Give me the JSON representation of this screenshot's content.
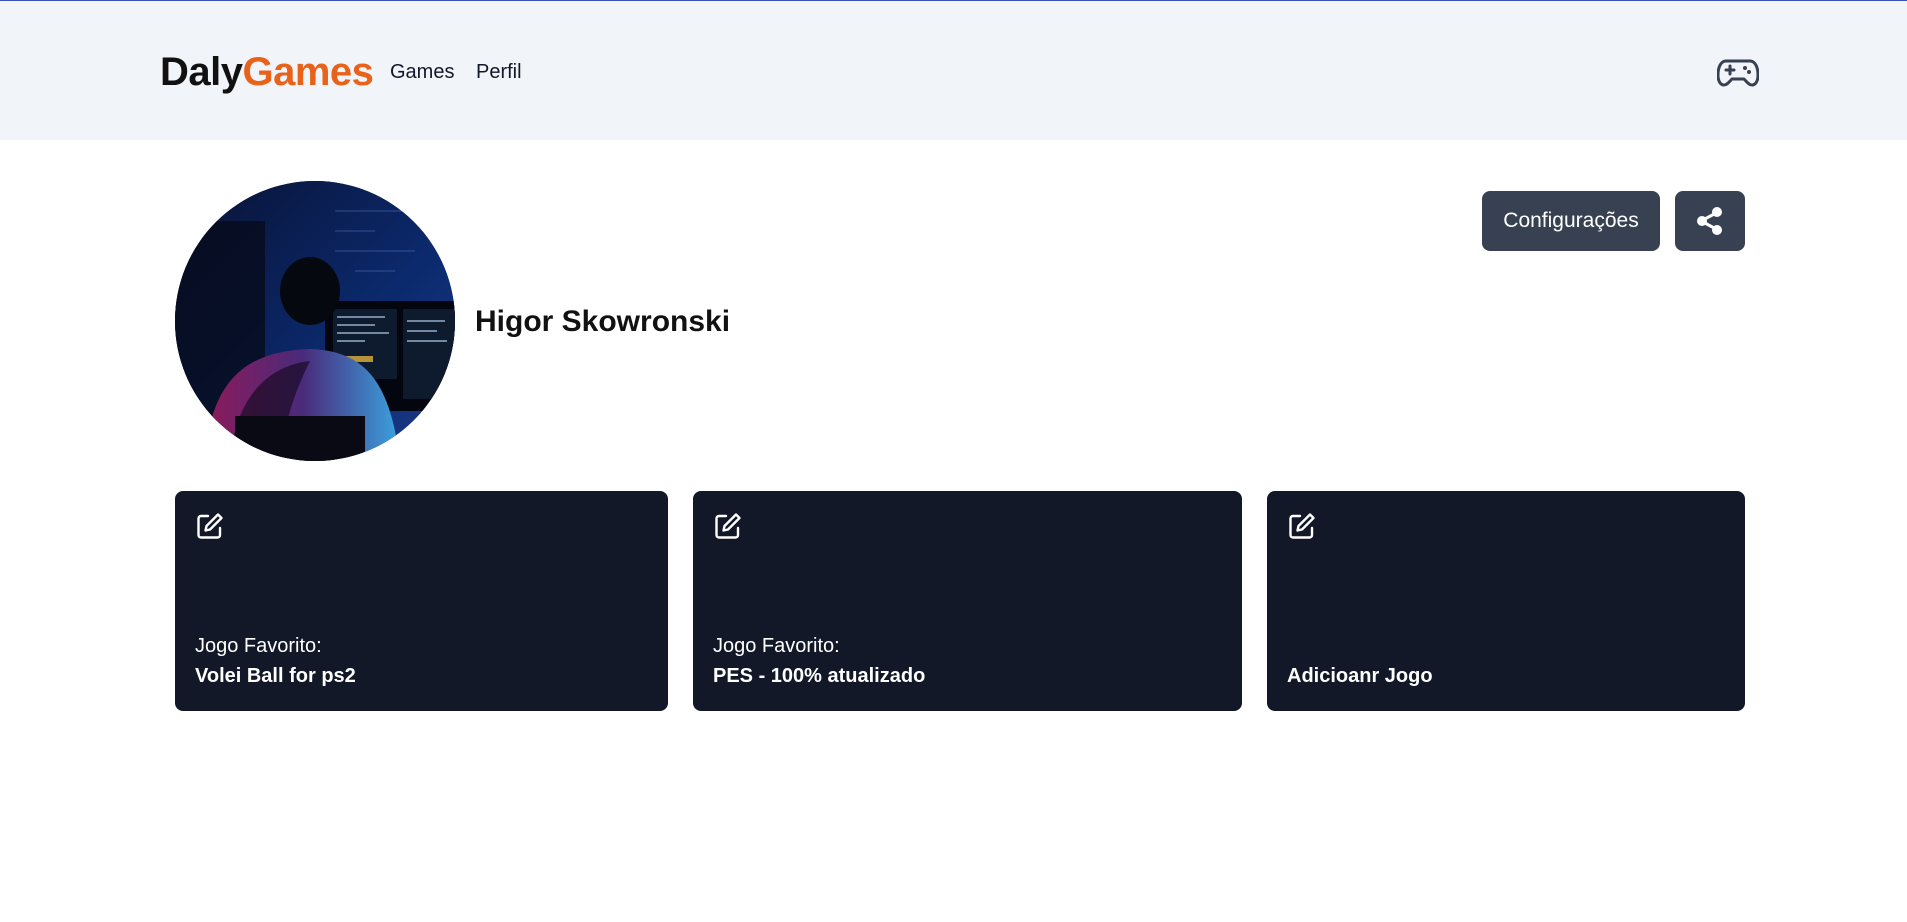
{
  "header": {
    "logo_part1": "Daly",
    "logo_part2": "Games",
    "nav": [
      {
        "label": "Games"
      },
      {
        "label": "Perfil"
      }
    ],
    "right_icon": "gamepad-icon"
  },
  "profile": {
    "name": "Higor Skowronski",
    "avatar_icon": "avatar-photo-developer-at-screens",
    "settings_label": "Configurações",
    "share_icon": "share-icon"
  },
  "cards": [
    {
      "label": "Jogo Favorito:",
      "title": "Volei Ball for ps2",
      "icon": "edit-icon"
    },
    {
      "label": "Jogo Favorito:",
      "title": "PES - 100% atualizado",
      "icon": "edit-icon"
    },
    {
      "label": "",
      "title": "Adicioanr Jogo",
      "icon": "edit-icon"
    }
  ],
  "colors": {
    "accent": "#e8621a",
    "header_bg": "#f1f4f9",
    "button_bg": "#374151",
    "card_bg": "#121828"
  }
}
